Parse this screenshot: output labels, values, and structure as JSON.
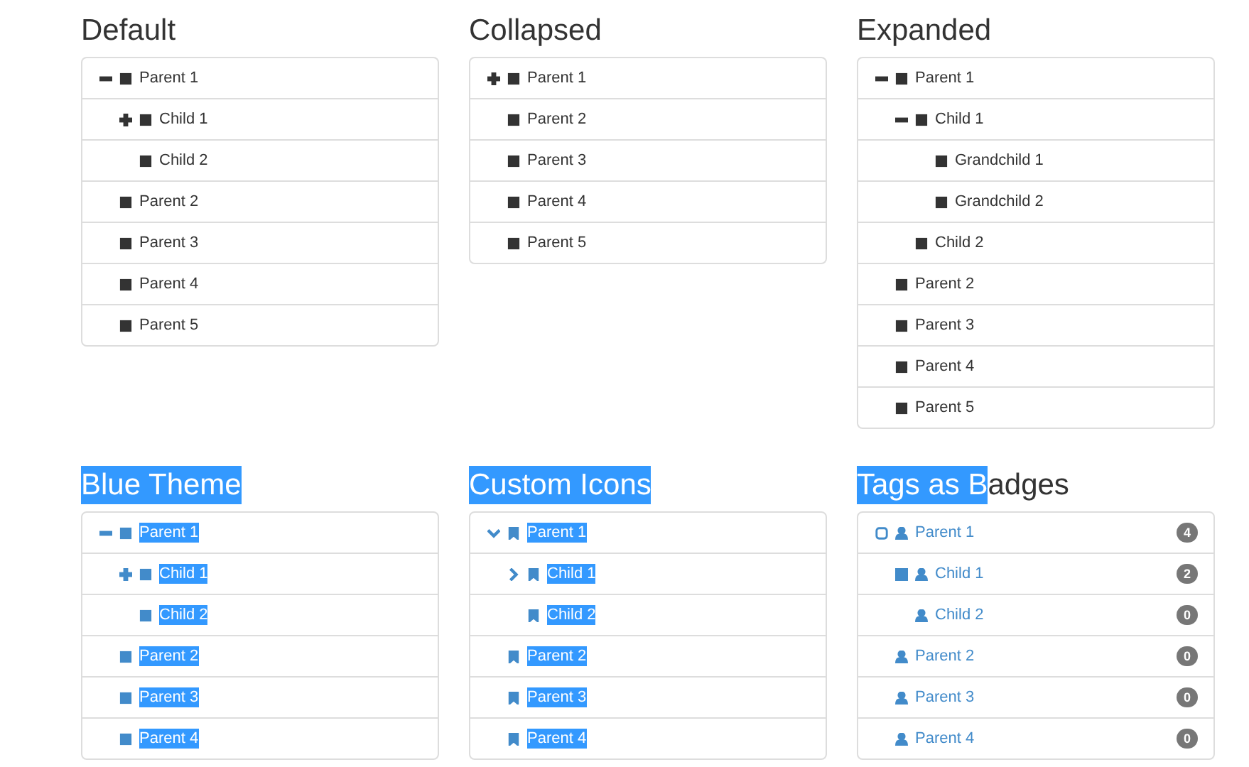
{
  "panels": [
    {
      "title": [
        {
          "text": "Default",
          "highlighted": false
        }
      ],
      "kind": "default",
      "text_highlighted": false,
      "nodes": [
        {
          "text": "Parent 1",
          "expanded": true,
          "children": [
            {
              "text": "Child 1",
              "expanded": false
            },
            {
              "text": "Child 2"
            }
          ]
        },
        {
          "text": "Parent 2"
        },
        {
          "text": "Parent 3"
        },
        {
          "text": "Parent 4"
        },
        {
          "text": "Parent 5"
        }
      ]
    },
    {
      "title": [
        {
          "text": "Collapsed",
          "highlighted": false
        }
      ],
      "kind": "default",
      "text_highlighted": false,
      "nodes": [
        {
          "text": "Parent 1",
          "expanded": false
        },
        {
          "text": "Parent 2"
        },
        {
          "text": "Parent 3"
        },
        {
          "text": "Parent 4"
        },
        {
          "text": "Parent 5"
        }
      ]
    },
    {
      "title": [
        {
          "text": "Expanded",
          "highlighted": false
        }
      ],
      "kind": "default",
      "text_highlighted": false,
      "nodes": [
        {
          "text": "Parent 1",
          "expanded": true,
          "children": [
            {
              "text": "Child 1",
              "expanded": true,
              "children": [
                {
                  "text": "Grandchild 1"
                },
                {
                  "text": "Grandchild 2"
                }
              ]
            },
            {
              "text": "Child 2"
            }
          ]
        },
        {
          "text": "Parent 2"
        },
        {
          "text": "Parent 3"
        },
        {
          "text": "Parent 4"
        },
        {
          "text": "Parent 5"
        }
      ]
    },
    {
      "title": [
        {
          "text": "Blue Theme",
          "highlighted": true
        }
      ],
      "kind": "blue",
      "text_highlighted": true,
      "nodes": [
        {
          "text": "Parent 1",
          "expanded": true,
          "children": [
            {
              "text": "Child 1",
              "expanded": false
            },
            {
              "text": "Child 2"
            }
          ]
        },
        {
          "text": "Parent 2"
        },
        {
          "text": "Parent 3"
        },
        {
          "text": "Parent 4"
        }
      ]
    },
    {
      "title": [
        {
          "text": "Custom Icons",
          "highlighted": true
        }
      ],
      "kind": "custom",
      "text_highlighted": true,
      "nodes": [
        {
          "text": "Parent 1",
          "expanded": true,
          "children": [
            {
              "text": "Child 1",
              "expanded": false
            },
            {
              "text": "Child 2"
            }
          ]
        },
        {
          "text": "Parent 2"
        },
        {
          "text": "Parent 3"
        },
        {
          "text": "Parent 4"
        }
      ]
    },
    {
      "title": [
        {
          "text": "Tags as B",
          "highlighted": true
        },
        {
          "text": "adges",
          "highlighted": false
        }
      ],
      "kind": "tags",
      "text_highlighted": false,
      "nodes": [
        {
          "text": "Parent 1",
          "badge": "4",
          "expanded": true,
          "children": [
            {
              "text": "Child 1",
              "badge": "2",
              "expanded": false
            },
            {
              "text": "Child 2",
              "badge": "0"
            }
          ]
        },
        {
          "text": "Parent 2",
          "badge": "0"
        },
        {
          "text": "Parent 3",
          "badge": "0"
        },
        {
          "text": "Parent 4",
          "badge": "0"
        }
      ]
    }
  ]
}
